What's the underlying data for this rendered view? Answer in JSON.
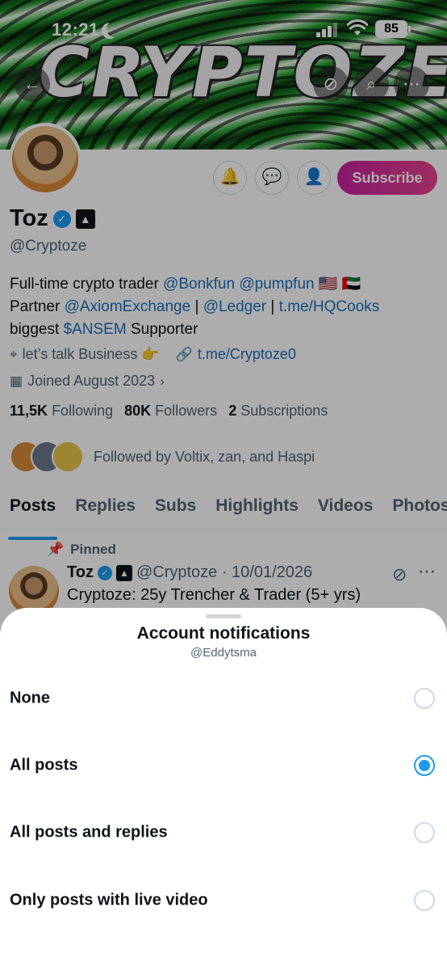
{
  "status_bar": {
    "time": "12:21",
    "battery": "85"
  },
  "banner": {
    "text": "CRYPTOZE"
  },
  "nav": {
    "back_icon": "back-arrow-icon",
    "grok_icon": "grok-icon",
    "search_icon": "search-icon",
    "more_icon": "more-icon"
  },
  "profile": {
    "name": "Toz",
    "handle": "@Cryptoze",
    "bio_line1_prefix": "Full-time crypto trader ",
    "bio_link1": "@Bonkfun",
    "bio_link2": "@pumpfun",
    "bio_line1_flags": " 🇺🇸 🇦🇪",
    "bio_line2_prefix": "Partner ",
    "bio_link3": "@AxiomExchange",
    "bio_sep1": " | ",
    "bio_link4": "@Ledger",
    "bio_sep2": " | ",
    "bio_link5": "t.me/HQCooks",
    "bio_line3_prefix": "biggest ",
    "bio_link6": "$ANSEM",
    "bio_line3_suffix": " Supporter",
    "location": "let’s talk Business 👉",
    "website": "t.me/Cryptoze0",
    "joined": "Joined August 2023",
    "following_count": "11,5K",
    "following_label": "Following",
    "followers_count": "80K",
    "followers_label": "Followers",
    "subscriptions_count": "2",
    "subscriptions_label": "Subscriptions",
    "followed_by": "Followed by Voltix, zan, and Haspi",
    "subscribe_label": "Subscribe"
  },
  "tabs": [
    "Posts",
    "Replies",
    "Subs",
    "Highlights",
    "Videos",
    "Photos"
  ],
  "pinned_post": {
    "pinned_label": "Pinned",
    "name": "Toz",
    "meta": "@Cryptoze · 10/01/2026",
    "text": "Cryptoze: 25y Trencher & Trader (5+ yrs)"
  },
  "sheet": {
    "title": "Account notifications",
    "subtitle": "@Eddytsma",
    "options": [
      {
        "label": "None",
        "selected": false
      },
      {
        "label": "All posts",
        "selected": true
      },
      {
        "label": "All posts and replies",
        "selected": false
      },
      {
        "label": "Only posts with live video",
        "selected": false
      }
    ]
  },
  "colors": {
    "accent": "#1d9bf0",
    "subscribe_start": "#c7239e",
    "subscribe_end": "#e8428c",
    "link": "#1d6fb8"
  }
}
